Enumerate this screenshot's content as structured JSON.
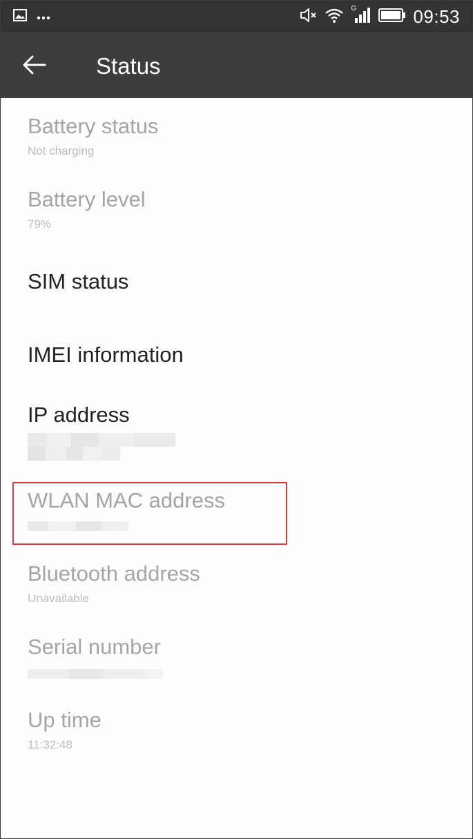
{
  "status_bar": {
    "time": "09:53",
    "icons": [
      "gallery-notification-icon",
      "more-notifications-icon",
      "mute-icon",
      "wifi-icon",
      "signal-icon",
      "battery-icon"
    ],
    "network_label": "G"
  },
  "app_bar": {
    "title": "Status",
    "back_icon": "arrow-left-icon"
  },
  "items": [
    {
      "title": "Battery status",
      "subtitle": "Not charging",
      "enabled": false
    },
    {
      "title": "Battery level",
      "subtitle": "79%",
      "enabled": false
    },
    {
      "title": "SIM status",
      "enabled": true
    },
    {
      "title": "IMEI information",
      "enabled": true
    },
    {
      "title": "IP address",
      "subtitle": "",
      "subtitle_obscured": true,
      "enabled": true
    },
    {
      "title": "WLAN MAC address",
      "subtitle": "",
      "subtitle_obscured": true,
      "enabled": false,
      "highlighted": true
    },
    {
      "title": "Bluetooth address",
      "subtitle": "Unavailable",
      "enabled": false
    },
    {
      "title": "Serial number",
      "subtitle": "",
      "subtitle_obscured": true,
      "enabled": false
    },
    {
      "title": "Up time",
      "subtitle": "11:32:48",
      "enabled": false
    }
  ],
  "colors": {
    "status_bar": "#333333",
    "app_bar": "#3d3d3d",
    "background": "#fdfdfd",
    "highlight_border": "#e03a3a",
    "disabled_text": "#a5a5a5",
    "enabled_text": "#222222"
  }
}
